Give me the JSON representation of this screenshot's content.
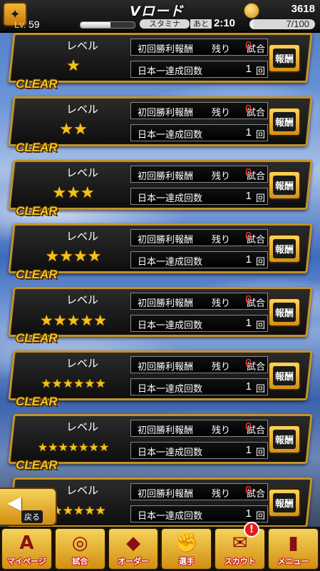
{
  "header": {
    "title": "Vロード",
    "coins": "3618",
    "level_label": "Lv.",
    "level": "59",
    "stamina_label": "スタミナ",
    "remaining_label": "あと",
    "timer": "2:10",
    "stamina": "7/100",
    "stamina_fraction": 0.07,
    "xp_fraction": 0.55
  },
  "card_labels": {
    "level": "レベル",
    "first_win_reward": "初回勝利報酬",
    "remaining": "残り",
    "games_unit": "試合",
    "japan_champion_count": "日本一達成回数",
    "times_unit": "回",
    "reward_button": "報酬",
    "clear": "CLEAR"
  },
  "levels": [
    {
      "stars": 1,
      "clear": false,
      "remaining_games": "0",
      "champion_count": "1"
    },
    {
      "stars": 2,
      "clear": true,
      "remaining_games": "0",
      "champion_count": "1"
    },
    {
      "stars": 3,
      "clear": true,
      "remaining_games": "0",
      "champion_count": "1"
    },
    {
      "stars": 4,
      "clear": true,
      "remaining_games": "0",
      "champion_count": "1"
    },
    {
      "stars": 5,
      "clear": true,
      "remaining_games": "0",
      "champion_count": "1"
    },
    {
      "stars": 6,
      "clear": true,
      "remaining_games": "0",
      "champion_count": "1"
    },
    {
      "stars": 7,
      "clear": true,
      "remaining_games": "0",
      "champion_count": "1"
    },
    {
      "stars": 6,
      "clear": true,
      "remaining_games": "0",
      "champion_count": "1"
    }
  ],
  "back_button": {
    "label": "戻る"
  },
  "bottom_menu": [
    {
      "label": "マイページ",
      "icon": "team-logo-icon"
    },
    {
      "label": "試合",
      "icon": "stadium-icon"
    },
    {
      "label": "オーダー",
      "icon": "field-icon"
    },
    {
      "label": "選手",
      "icon": "player-icon"
    },
    {
      "label": "スカウト",
      "icon": "scout-icon"
    },
    {
      "label": "メニュー",
      "icon": "menu-character-icon"
    }
  ],
  "scout_badge": "!",
  "colors": {
    "gold": "#f4c520",
    "remaining_red": "#ff3a3a",
    "card_border": "#c59223"
  }
}
